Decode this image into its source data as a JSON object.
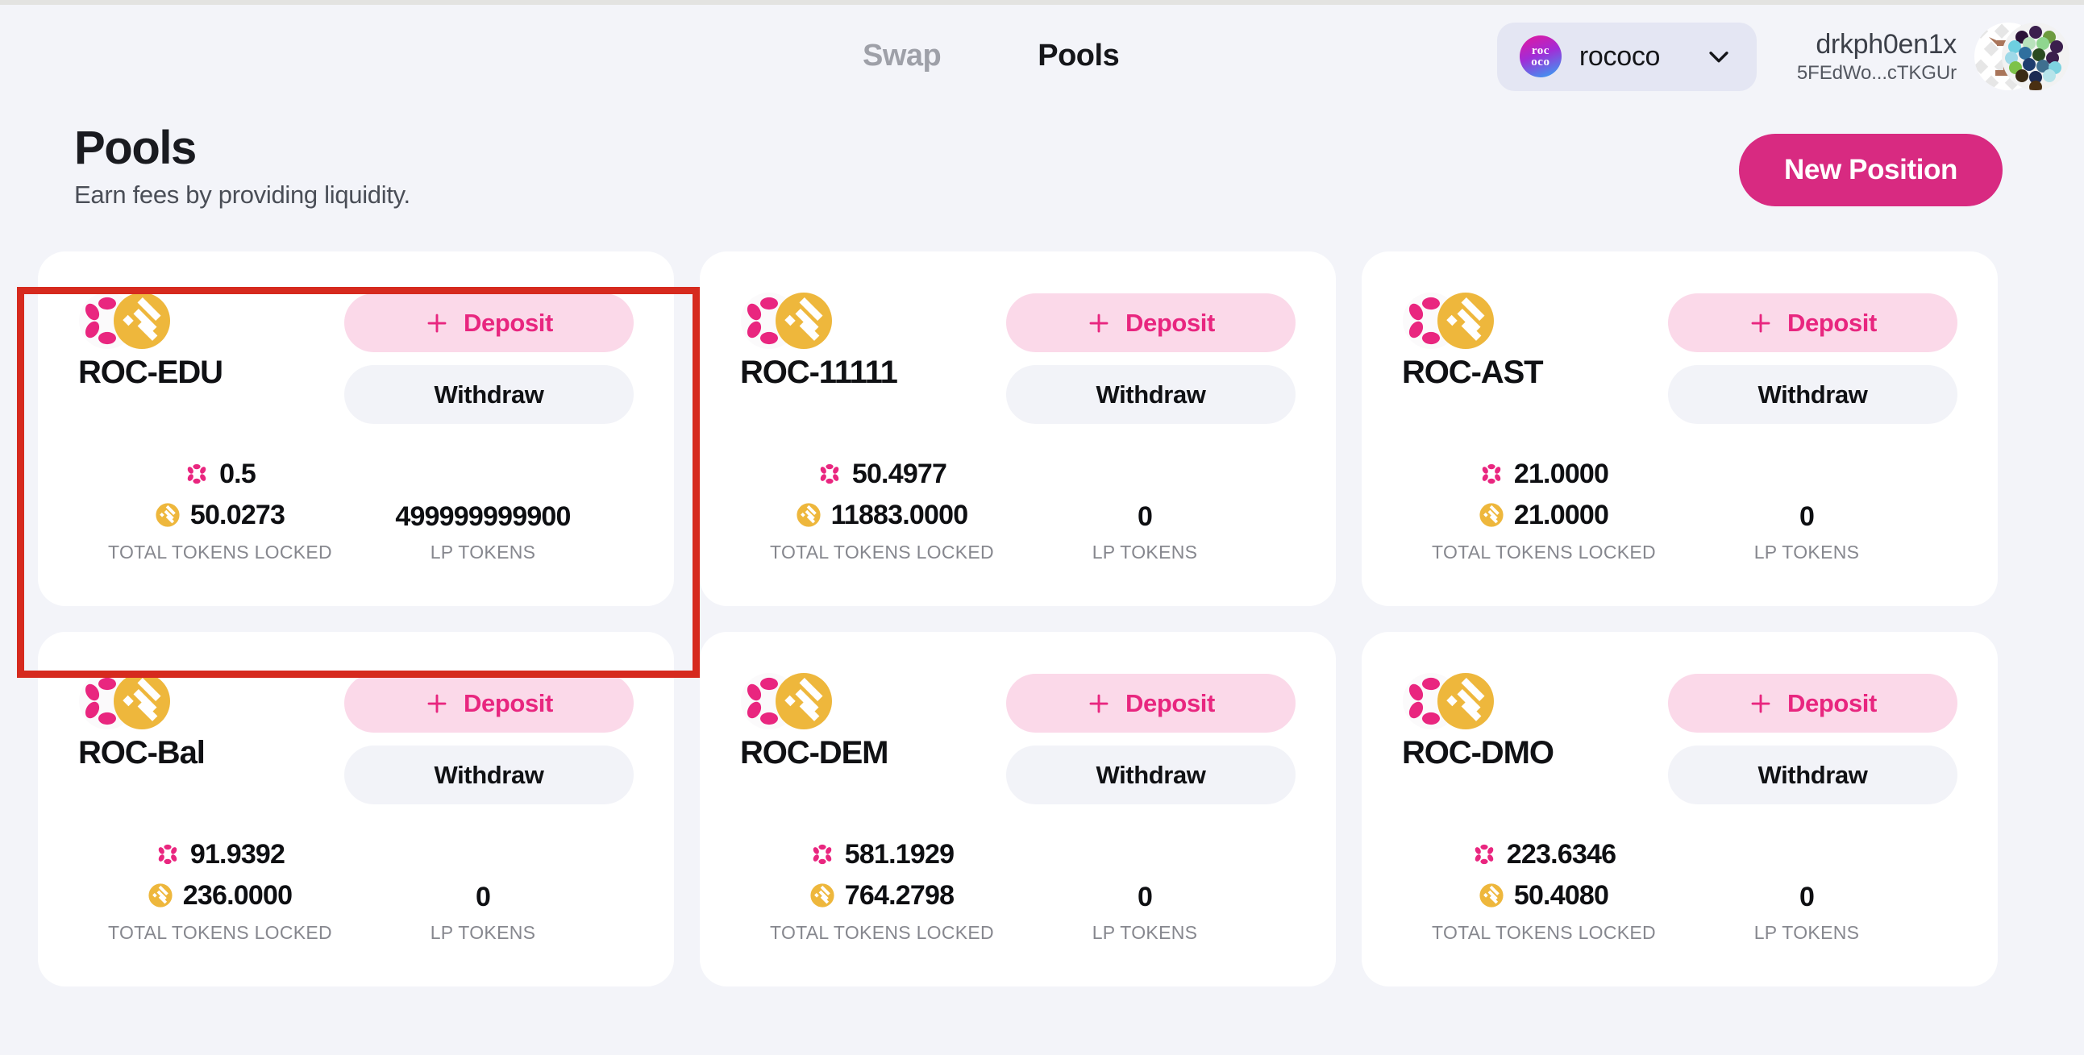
{
  "header": {
    "tabs": [
      {
        "label": "Swap",
        "active": false
      },
      {
        "label": "Pools",
        "active": true
      }
    ],
    "chain_selector": {
      "name": "rococo",
      "logo_line1": "roc",
      "logo_line2": "oco",
      "chevron_icon": "chevron-down-icon"
    },
    "account": {
      "name": "drkph0en1x",
      "address": "5FEdWo...cTKGUr",
      "avatar_icon": "polkadot-identicon-avatar"
    }
  },
  "page": {
    "title": "Pools",
    "subtitle": "Earn fees by providing liquidity.",
    "new_position_label": "New Position"
  },
  "labels": {
    "deposit": "Deposit",
    "withdraw": "Withdraw",
    "total_tokens_locked": "TOTAL TOKENS LOCKED",
    "lp_tokens": "LP TOKENS",
    "plus_icon": "plus-icon",
    "token_a_icon": "polkadot-token-icon",
    "token_b_icon": "asset-token-icon"
  },
  "colors": {
    "page_background": "#f3f4f9",
    "card_background": "#ffffff",
    "accent_pink": "#d82a81",
    "deposit_bg": "#fbd9e9",
    "deposit_text": "#e8267f",
    "withdraw_bg": "#f2f3f8",
    "token_a": "#e9267f",
    "token_b": "#eeb73c",
    "highlight_border": "#d62a1e",
    "tab_inactive": "#9ea0a8",
    "tab_active": "#15161a",
    "muted_text": "#86878e"
  },
  "pools": [
    {
      "pair": "ROC-EDU",
      "token_a_amount": "0.5",
      "token_b_amount": "50.0273",
      "lp_tokens": "499999999900",
      "highlighted": true
    },
    {
      "pair": "ROC-11111",
      "token_a_amount": "50.4977",
      "token_b_amount": "11883.0000",
      "lp_tokens": "0",
      "highlighted": false
    },
    {
      "pair": "ROC-AST",
      "token_a_amount": "21.0000",
      "token_b_amount": "21.0000",
      "lp_tokens": "0",
      "highlighted": false
    },
    {
      "pair": "ROC-Bal",
      "token_a_amount": "91.9392",
      "token_b_amount": "236.0000",
      "lp_tokens": "0",
      "highlighted": false
    },
    {
      "pair": "ROC-DEM",
      "token_a_amount": "581.1929",
      "token_b_amount": "764.2798",
      "lp_tokens": "0",
      "highlighted": false
    },
    {
      "pair": "ROC-DMO",
      "token_a_amount": "223.6346",
      "token_b_amount": "50.4080",
      "lp_tokens": "0",
      "highlighted": false
    }
  ]
}
